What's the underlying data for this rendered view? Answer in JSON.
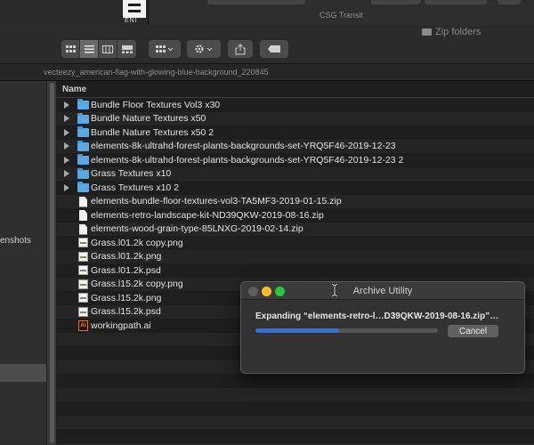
{
  "background_window": {
    "title": "CSG Transit"
  },
  "toolbar": {
    "zip_folders_label": "Zip folders"
  },
  "path_bar": {
    "current": "vecteezy_american-flag-with-glowing-blue-background_220845"
  },
  "sidebar": {
    "partial_label": "enshots"
  },
  "file_list": {
    "column_header": "Name",
    "items": [
      {
        "name": "Bundle Floor Textures Vol3 x30",
        "type": "folder"
      },
      {
        "name": "Bundle Nature Textures x50",
        "type": "folder"
      },
      {
        "name": "Bundle Nature Textures x50 2",
        "type": "folder"
      },
      {
        "name": "elements-8k-ultrahd-forest-plants-backgrounds-set-YRQ5F46-2019-12-23",
        "type": "folder"
      },
      {
        "name": "elements-8k-ultrahd-forest-plants-backgrounds-set-YRQ5F46-2019-12-23 2",
        "type": "folder"
      },
      {
        "name": "Grass Textures x10",
        "type": "folder"
      },
      {
        "name": "Grass Textures x10 2",
        "type": "folder"
      },
      {
        "name": "elements-bundle-floor-textures-vol3-TA5MF3-2019-01-15.zip",
        "type": "zip"
      },
      {
        "name": "elements-retro-landscape-kit-ND39QKW-2019-08-16.zip",
        "type": "zip"
      },
      {
        "name": "elements-wood-grain-type-85LNXG-2019-02-14.zip",
        "type": "zip"
      },
      {
        "name": "Grass.l01.2k copy.png",
        "type": "image"
      },
      {
        "name": "Grass.l01.2k.png",
        "type": "image"
      },
      {
        "name": "Grass.l01.2k.psd",
        "type": "image"
      },
      {
        "name": "Grass.l15.2k copy.png",
        "type": "image"
      },
      {
        "name": "Grass.l15.2k.png",
        "type": "image"
      },
      {
        "name": "Grass.l15.2k.psd",
        "type": "image"
      },
      {
        "name": "workingpath.ai",
        "type": "ai"
      }
    ]
  },
  "dialog": {
    "title": "Archive Utility",
    "message": "Expanding “elements-retro-l…D39QKW-2019-08-16.zip”…",
    "progress": 0.46,
    "cancel_label": "Cancel"
  },
  "colors": {
    "accent": "#2f6fe0",
    "folder": "#59a9e4",
    "close": "#ff5f57",
    "minimize": "#febc2e",
    "zoom": "#28c840"
  }
}
